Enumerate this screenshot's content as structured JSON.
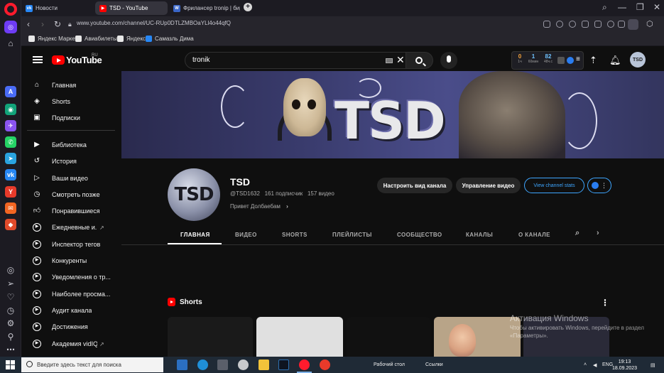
{
  "browser": {
    "tabs": [
      {
        "label": "Новости",
        "icon": "vk-icon"
      },
      {
        "label": "TSD - YouTube",
        "icon": "youtube-icon"
      },
      {
        "label": "Фрилансер tronip | бир...",
        "icon": "w-icon"
      }
    ],
    "new_tab": "+",
    "url": "www.youtube.com/channel/UC-RUp0DTLZMBOaYLl4o44qfQ",
    "bookmarks": [
      "Яндекс Маркет",
      "Авиабилеты",
      "Яндекс",
      "Самазль Дима"
    ]
  },
  "youtube": {
    "logo_text": "YouTube",
    "logo_region": "RU",
    "search": {
      "query": "tronik"
    },
    "vidiq": {
      "cells": [
        {
          "num": "0",
          "label": "1ч",
          "color": "#f4a23a"
        },
        {
          "num": "1",
          "label": "60мин",
          "color": "#6fc3ff"
        },
        {
          "num": "82",
          "label": "48ч.с",
          "color": "#6fc3ff"
        }
      ]
    },
    "avatar_text": "TSD"
  },
  "sidebar": {
    "items": [
      {
        "label": "Главная",
        "icon": "home-icon"
      },
      {
        "label": "Shorts",
        "icon": "shorts-icon"
      },
      {
        "label": "Подписки",
        "icon": "subscriptions-icon"
      },
      {
        "label": "Библиотека",
        "icon": "library-icon"
      },
      {
        "label": "История",
        "icon": "history-icon"
      },
      {
        "label": "Ваши видео",
        "icon": "your-videos-icon"
      },
      {
        "label": "Смотреть позже",
        "icon": "watch-later-icon"
      },
      {
        "label": "Понравившиеся",
        "icon": "liked-icon"
      },
      {
        "label": "Ежедневные и...",
        "icon": "vidiq-icon",
        "external": true
      },
      {
        "label": "Инспектор тегов",
        "icon": "vidiq-icon"
      },
      {
        "label": "Конкуренты",
        "icon": "vidiq-icon"
      },
      {
        "label": "Уведомления о тр...",
        "icon": "vidiq-icon"
      },
      {
        "label": "Наиболее просма...",
        "icon": "vidiq-icon"
      },
      {
        "label": "Аудит канала",
        "icon": "vidiq-icon"
      },
      {
        "label": "Достижения",
        "icon": "vidiq-icon"
      },
      {
        "label": "Академия vidIQ",
        "icon": "vidiq-icon",
        "external": true
      }
    ]
  },
  "channel": {
    "banner_text": "TSD",
    "avatar_text": "TSD",
    "name": "TSD",
    "handle": "@TSD1632",
    "subscribers": "161 подписчик",
    "videos": "157 видео",
    "description": "Привет Долбаебам",
    "buttons": {
      "customize": "Настроить вид канала",
      "manage": "Управление видео",
      "stats": "View channel stats"
    },
    "tabs": [
      "ГЛАВНАЯ",
      "ВИДЕО",
      "SHORTS",
      "ПЛЕЙЛИСТЫ",
      "СООБЩЕСТВО",
      "КАНАЛЫ",
      "О КАНАЛЕ"
    ],
    "active_tab": "ГЛАВНАЯ"
  },
  "shorts": {
    "title": "Shorts",
    "more": "⋮"
  },
  "os_watermark": {
    "line1": "Активация Windows",
    "line2": "Чтобы активировать Windows, перейдите в раздел",
    "line3": "«Параметры»."
  },
  "taskbar": {
    "search_placeholder": "Введите здесь текст для поиска",
    "desktop_label": "Рабочий стол",
    "links_label": "Ссылки",
    "lang": "ENG",
    "time": "19:13",
    "date": "18.09.2023"
  }
}
